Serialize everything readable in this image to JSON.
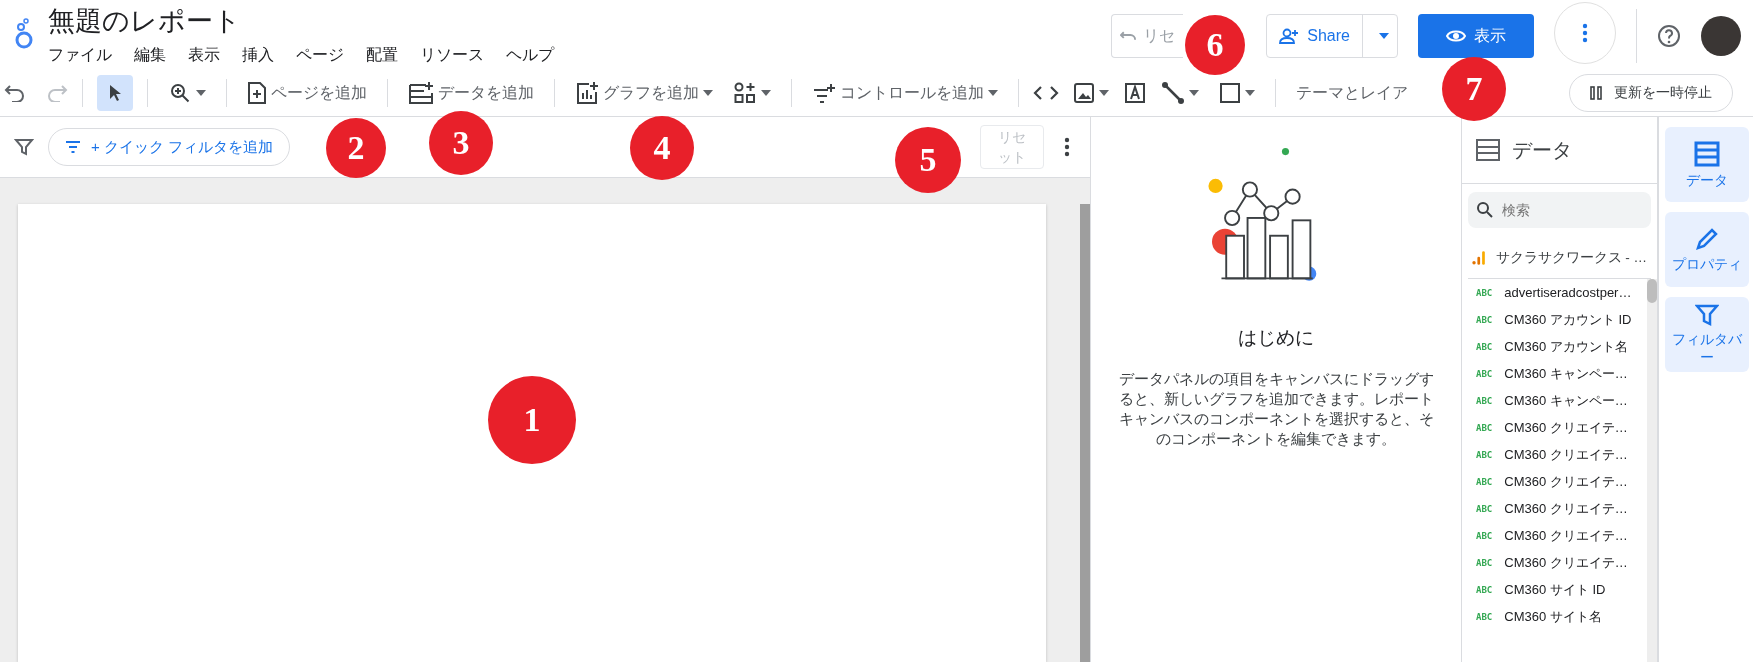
{
  "app": {
    "title": "無題のレポート",
    "menu": [
      "ファイル",
      "編集",
      "表示",
      "挿入",
      "ページ",
      "配置",
      "リソース",
      "ヘルプ"
    ]
  },
  "header_actions": {
    "reset": {
      "label": "リセ",
      "disabled": true
    },
    "share": {
      "label": "Share"
    },
    "view": {
      "label": "表示"
    }
  },
  "toolbar": {
    "select_tool": {
      "selected": true
    },
    "add_page": "ページを追加",
    "add_data": "データを追加",
    "add_chart": "グラフを追加",
    "add_control": "コントロールを追加",
    "theme": "テーマとレイア",
    "pause": "更新を一時停止"
  },
  "filter_bar": {
    "quick_filter": "+ クイック フィルタを追加",
    "reset": {
      "label": "リセット",
      "disabled": true
    }
  },
  "getting_started": {
    "title": "はじめに",
    "body": "データパネルの項目をキャンバスにドラッグすると、新しいグラフを追加できます。レポートキャンバスのコンポーネントを選択すると、そのコンポーネントを編集できます。"
  },
  "data_panel": {
    "title": "データ",
    "search": {
      "placeholder": "検索"
    },
    "source": "サクラサクワークス - …",
    "fields": [
      {
        "type": "ABC",
        "name": "advertiseradcostper…"
      },
      {
        "type": "ABC",
        "name": "CM360 アカウント ID"
      },
      {
        "type": "ABC",
        "name": "CM360 アカウント名"
      },
      {
        "type": "ABC",
        "name": "CM360 キャンペー…"
      },
      {
        "type": "ABC",
        "name": "CM360 キャンペー…"
      },
      {
        "type": "ABC",
        "name": "CM360 クリエイテ…"
      },
      {
        "type": "ABC",
        "name": "CM360 クリエイテ…"
      },
      {
        "type": "ABC",
        "name": "CM360 クリエイテ…"
      },
      {
        "type": "ABC",
        "name": "CM360 クリエイテ…"
      },
      {
        "type": "ABC",
        "name": "CM360 クリエイテ…"
      },
      {
        "type": "ABC",
        "name": "CM360 クリエイテ…"
      },
      {
        "type": "ABC",
        "name": "CM360 サイト ID"
      },
      {
        "type": "ABC",
        "name": "CM360 サイト名"
      }
    ]
  },
  "rail": [
    {
      "label": "データ"
    },
    {
      "label": "プロパティ"
    },
    {
      "label": "フィルタバー"
    }
  ],
  "markers": [
    "1",
    "2",
    "3",
    "4",
    "5",
    "6",
    "7"
  ]
}
